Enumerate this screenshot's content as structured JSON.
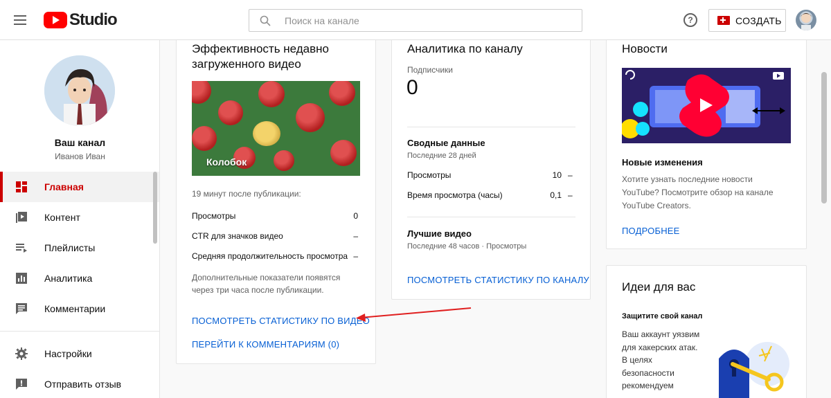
{
  "header": {
    "logo_text": "Studio",
    "search_placeholder": "Поиск на канале",
    "help_symbol": "?",
    "create_label": "СОЗДАТЬ"
  },
  "sidebar": {
    "channel_name": "Ваш канал",
    "channel_user": "Иванов Иван",
    "items": [
      {
        "label": "Главная",
        "icon": "dashboard-icon",
        "active": true
      },
      {
        "label": "Контент",
        "icon": "video-library-icon"
      },
      {
        "label": "Плейлисты",
        "icon": "playlist-icon"
      },
      {
        "label": "Аналитика",
        "icon": "analytics-icon"
      },
      {
        "label": "Комментарии",
        "icon": "comments-icon"
      },
      {
        "label": "Настройки",
        "icon": "gear-icon"
      },
      {
        "label": "Отправить отзыв",
        "icon": "feedback-icon"
      }
    ]
  },
  "video_card": {
    "title_line1": "Эффективность недавно",
    "title_line2": "загруженного видео",
    "thumbnail_caption": "Колобок",
    "published": "19 минут после публикации:",
    "metrics": [
      {
        "label": "Просмотры",
        "value": "0"
      },
      {
        "label": "CTR для значков видео",
        "value": "–"
      },
      {
        "label": "Средняя продолжительность просмотра",
        "value": "–"
      }
    ],
    "note_line1": "Дополнительные показатели появятся",
    "note_line2": "через три часа после публикации.",
    "link_stats": "ПОСМОТРЕТЬ СТАТИСТИКУ ПО ВИДЕО",
    "link_comments": "ПЕРЕЙТИ К КОММЕНТАРИЯМ (0)"
  },
  "analytics_card": {
    "title": "Аналитика по каналу",
    "subscribers_label": "Подписчики",
    "subscribers_value": "0",
    "summary_title": "Сводные данные",
    "summary_period": "Последние 28 дней",
    "summary_rows": [
      {
        "label": "Просмотры",
        "value": "10",
        "delta": "–"
      },
      {
        "label": "Время просмотра (часы)",
        "value": "0,1",
        "delta": "–"
      }
    ],
    "top_videos_title": "Лучшие видео",
    "top_videos_period": "Последние 48 часов · Просмотры",
    "link": "ПОСМОТРЕТЬ СТАТИСТИКУ ПО КАНАЛУ"
  },
  "news_card": {
    "title": "Новости",
    "item_title": "Новые изменения",
    "item_text_line1": "Хотите узнать последние новости",
    "item_text_line2": "YouTube? Посмотрите обзор на канале",
    "item_text_line3": "YouTube Creators.",
    "link": "ПОДРОБНЕЕ"
  },
  "ideas_card": {
    "title": "Идеи для вас",
    "subtitle": "Защитите свой канал",
    "text_lines": [
      "Ваш аккаунт уязвим",
      "для хакерских атак.",
      "В целях",
      "безопасности",
      "рекомендуем"
    ]
  },
  "colors": {
    "accent": "#cc0000",
    "link": "#065fd4",
    "annotation_arrow": "#e02020"
  }
}
